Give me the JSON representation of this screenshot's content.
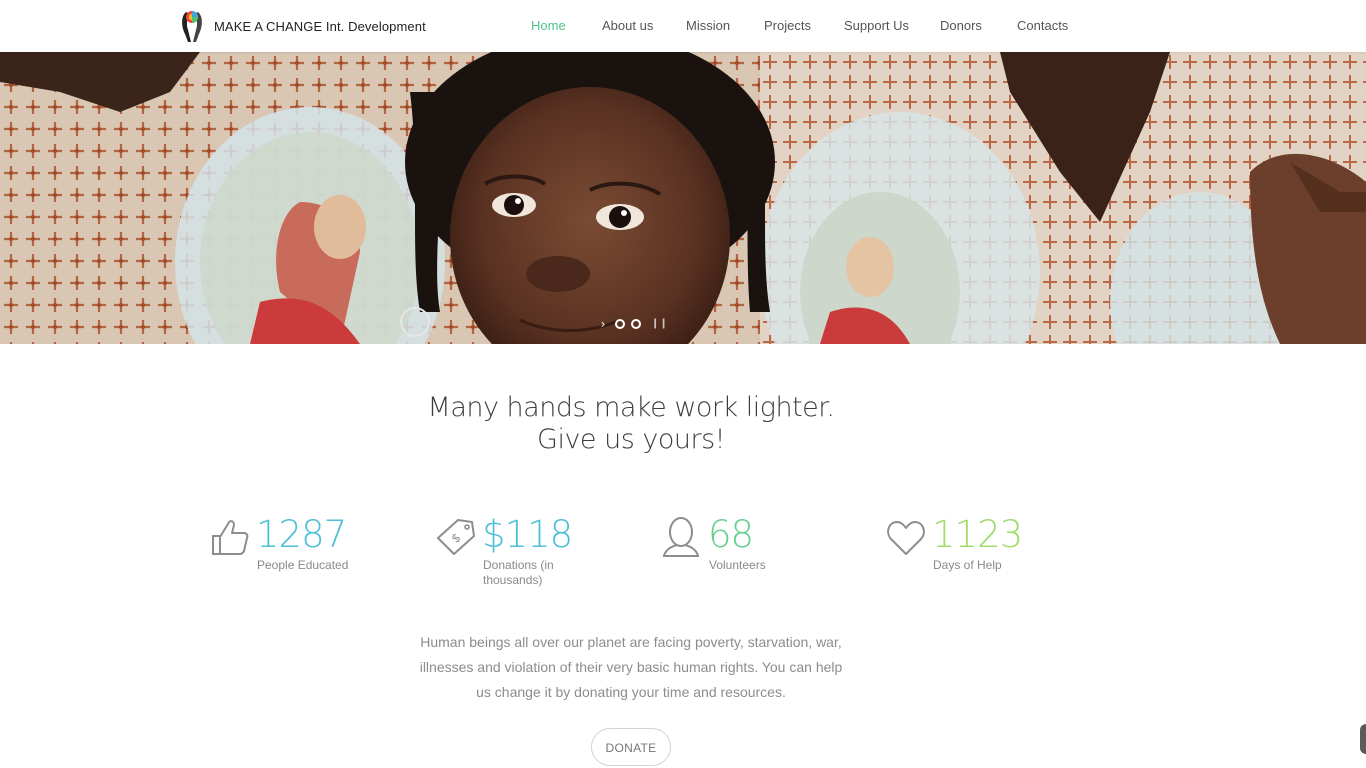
{
  "brand": {
    "name": "MAKE A CHANGE Int. Development"
  },
  "nav": {
    "items": [
      {
        "label": "Home",
        "active": true
      },
      {
        "label": "About us",
        "active": false
      },
      {
        "label": "Mission",
        "active": false
      },
      {
        "label": "Projects",
        "active": false
      },
      {
        "label": "Support Us",
        "active": false
      },
      {
        "label": "Donors",
        "active": false
      },
      {
        "label": "Contacts",
        "active": false
      }
    ],
    "active_color": "#4cc488"
  },
  "hero": {
    "image_description_icon": "slider-image",
    "slides_count": 2,
    "active_slide": 0
  },
  "headline": "Many hands make work lighter. Give us yours!",
  "stats": [
    {
      "icon": "thumbs-up-icon",
      "number": "1287",
      "label": "People Educated",
      "color": "#4dbfd6"
    },
    {
      "icon": "money-tag-icon",
      "number": "$118",
      "label": "Donations (in thousands)",
      "color": "#4dbfd6"
    },
    {
      "icon": "person-icon",
      "number": "68",
      "label": "Volunteers",
      "color": "#66cf8f"
    },
    {
      "icon": "heart-icon",
      "number": "1123",
      "label": "Days of Help",
      "color": "#9fdc6a"
    }
  ],
  "description": "Human beings all over our planet are facing poverty, starvation, war, illnesses and violation of their very basic human rights. You can help us change it by donating your time and resources.",
  "donate": {
    "label": "DONATE"
  }
}
